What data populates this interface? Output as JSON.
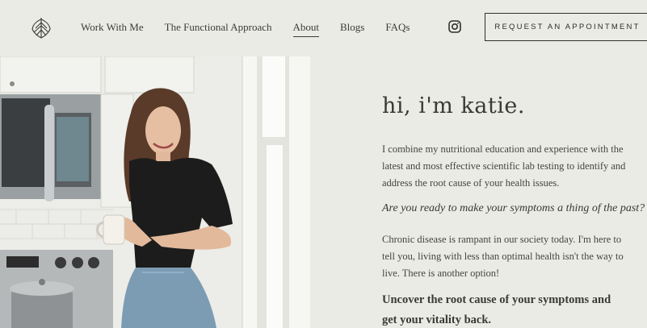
{
  "nav": {
    "items": [
      {
        "label": "Work With Me"
      },
      {
        "label": "The Functional Approach"
      },
      {
        "label": "About",
        "active": true
      },
      {
        "label": "Blogs"
      },
      {
        "label": "FAQs"
      }
    ],
    "cta_label": "REQUEST AN APPOINTMENT",
    "social_icon": "instagram-icon",
    "logo_icon": "leaf-logo-icon"
  },
  "main": {
    "title": "hi, i'm katie.",
    "intro": "I combine my nutritional education and experience with the latest and most effective scientific lab testing to identify and address the root cause of your health issues.",
    "question": "Are you ready to make your symptoms a thing of the past?",
    "body": "Chronic disease is rampant in our society today. I'm here to tell you, living with less than optimal health isn't the way to live. There is another option!",
    "subheading": "Uncover the root cause of your symptoms and get your vitality back."
  },
  "colors": {
    "background": "#ebebe5",
    "text": "#3a3a35"
  }
}
